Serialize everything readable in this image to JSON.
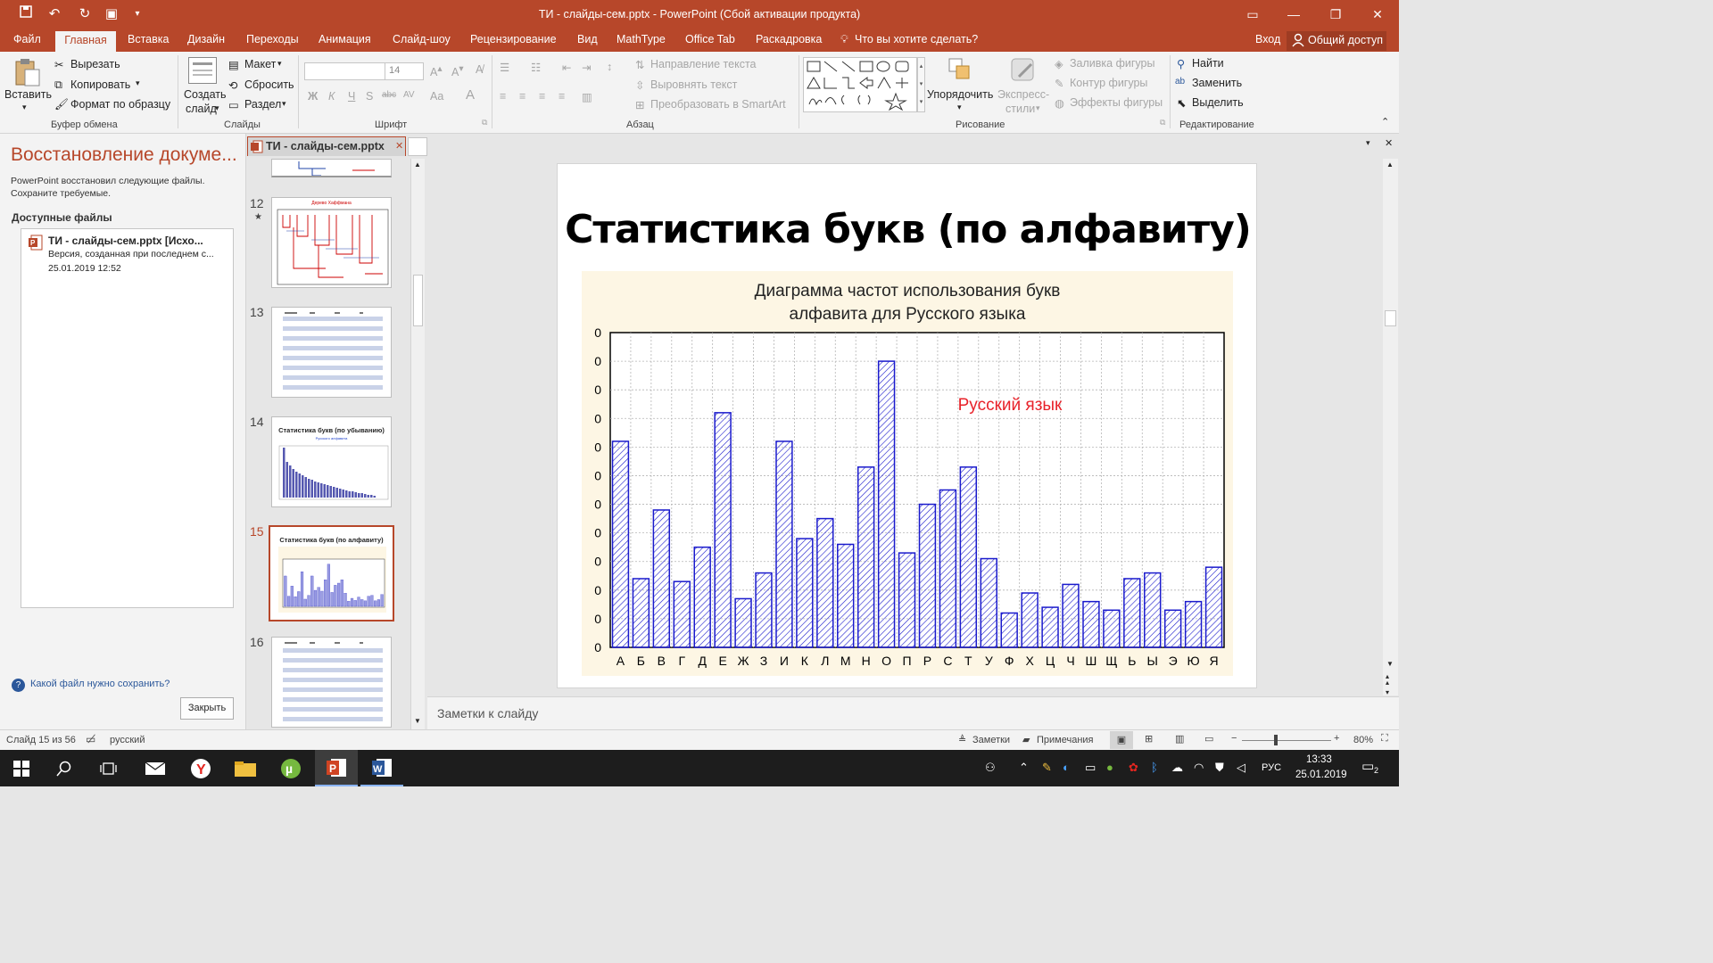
{
  "window": {
    "title": "ТИ - слайды-сем.pptx - PowerPoint (Сбой активации продукта)"
  },
  "ribbon_tabs": [
    "Файл",
    "Главная",
    "Вставка",
    "Дизайн",
    "Переходы",
    "Анимация",
    "Слайд-шоу",
    "Рецензирование",
    "Вид",
    "MathType",
    "Office Tab",
    "Раскадровка"
  ],
  "tell_me": "Что вы хотите сделать?",
  "sign_in": "Вход",
  "share": "Общий доступ",
  "ribbon": {
    "paste": "Вставить",
    "cut": "Вырезать",
    "copy": "Копировать",
    "format_painter": "Формат по образцу",
    "clipboard_group": "Буфер обмена",
    "new_slide_1": "Создать",
    "new_slide_2": "слайд",
    "layout": "Макет",
    "reset": "Сбросить",
    "section": "Раздел",
    "slides_group": "Слайды",
    "font_size": "14",
    "font_group": "Шрифт",
    "text_direction": "Направление текста",
    "align_text": "Выровнять текст",
    "smartart": "Преобразовать в SmartArt",
    "paragraph_group": "Абзац",
    "arrange": "Упорядочить",
    "quick_styles_1": "Экспресс-",
    "quick_styles_2": "стили",
    "shape_fill": "Заливка фигуры",
    "shape_outline": "Контур фигуры",
    "shape_effects": "Эффекты фигуры",
    "drawing_group": "Рисование",
    "find": "Найти",
    "replace": "Заменить",
    "select": "Выделить",
    "editing_group": "Редактирование"
  },
  "recovery": {
    "title": "Восстановление докуме...",
    "description": "PowerPoint восстановил следующие файлы. Сохраните требуемые.",
    "available": "Доступные файлы",
    "file_name": "ТИ - слайды-сем.pptx  [Исхо...",
    "file_version": "Версия, созданная при последнем с...",
    "file_date": "25.01.2019 12:52",
    "help": "Какой файл нужно сохранить?",
    "close": "Закрыть"
  },
  "doc_tab": "ТИ - слайды-сем.pptx",
  "thumbnails": [
    {
      "num": "12",
      "title": "Дерево Хаффмана"
    },
    {
      "num": "13",
      "title": ""
    },
    {
      "num": "14",
      "title": "Статистика букв (по убыванию)",
      "subtitle": "Русского алфавита"
    },
    {
      "num": "15",
      "title": "Статистика букв (по алфавиту)"
    },
    {
      "num": "16",
      "title": ""
    }
  ],
  "slide": {
    "title": "Статистика букв (по алфавиту)"
  },
  "chart_data": {
    "type": "bar",
    "title_line1": "Диаграмма частот использования букв",
    "title_line2": "алфавита для Русского языка",
    "annotation": "Русский язык",
    "categories": [
      "А",
      "Б",
      "В",
      "Г",
      "Д",
      "Е",
      "Ж",
      "З",
      "И",
      "К",
      "Л",
      "М",
      "Н",
      "О",
      "П",
      "Р",
      "С",
      "Т",
      "У",
      "Ф",
      "Х",
      "Ц",
      "Ч",
      "Ш",
      "Щ",
      "Ь",
      "Ы",
      "Э",
      "Ю",
      "Я"
    ],
    "values": [
      72,
      24,
      48,
      23,
      35,
      82,
      17,
      26,
      72,
      38,
      45,
      36,
      63,
      100,
      33,
      50,
      55,
      63,
      31,
      12,
      19,
      14,
      22,
      16,
      13,
      24,
      26,
      13,
      16,
      28
    ],
    "ytick_labels": [
      "0",
      "0",
      "0",
      "0",
      "0",
      "0",
      "0",
      "0",
      "0",
      "0",
      "0",
      "0"
    ],
    "ylim": [
      0,
      110
    ],
    "grid": true,
    "bar_color": "#1a1acc"
  },
  "notes_placeholder": "Заметки к слайду",
  "status": {
    "slide_info": "Слайд 15 из 56",
    "language": "русский",
    "notes": "Заметки",
    "comments": "Примечания",
    "zoom": "80%"
  },
  "taskbar": {
    "lang": "РУС",
    "time": "13:33",
    "date": "25.01.2019",
    "notification_count": "2"
  }
}
